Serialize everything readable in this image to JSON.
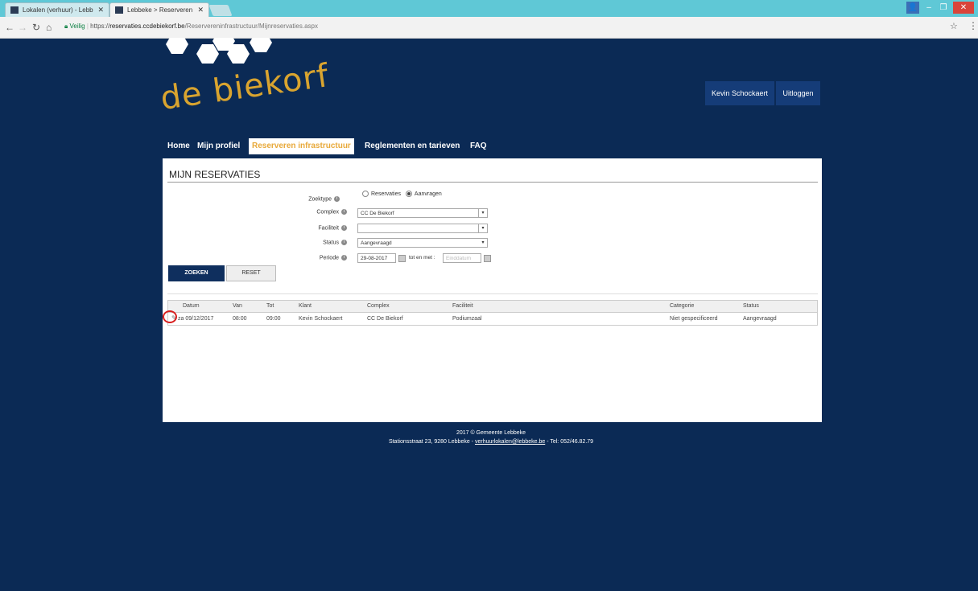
{
  "browser": {
    "tabs": [
      {
        "label": "Lokalen (verhuur) - Lebb"
      },
      {
        "label": "Lebbeke > Reserveren in"
      }
    ],
    "url": {
      "secure_label": "Veilig",
      "scheme": "https://",
      "host": "reservaties.ccdebiekorf.be",
      "path": "/Reservereninfrastructuur/Mijnreservaties.aspx"
    }
  },
  "header": {
    "logo_text": "de biekorf",
    "user_name": "Kevin Schockaert",
    "logout_label": "Uitloggen"
  },
  "nav": {
    "items": [
      {
        "label": "Home"
      },
      {
        "label": "Mijn profiel"
      },
      {
        "label": "Reserveren infrastructuur"
      },
      {
        "label": "Reglementen en tarieven"
      },
      {
        "label": "FAQ"
      }
    ],
    "active_index": 2
  },
  "page": {
    "title": "MIJN RESERVATIES",
    "form": {
      "zoektype_label": "Zoektype",
      "zoektype_options": [
        "Reservaties",
        "Aanvragen"
      ],
      "zoektype_selected": "Aanvragen",
      "complex_label": "Complex",
      "complex_value": "CC De Biekorf",
      "faciliteit_label": "Faciliteit",
      "faciliteit_value": "",
      "status_label": "Status",
      "status_value": "Aangevraagd",
      "periode_label": "Periode",
      "periode_start": "29-08-2017",
      "tot_en_met_label": "tot en met :",
      "periode_end_placeholder": "Einddatum"
    },
    "buttons": {
      "zoeken": "ZOEKEN",
      "reset": "RESET"
    },
    "table": {
      "columns": [
        "Datum",
        "Van",
        "Tot",
        "Klant",
        "Complex",
        "Faciliteit",
        "Categorie",
        "Status"
      ],
      "rows": [
        [
          "za 09/12/2017",
          "08:00",
          "09:00",
          "Kevin Schockaert",
          "CC De Biekorf",
          "Podiumzaal",
          "Niet gespecificeerd",
          "Aangevraagd"
        ]
      ]
    }
  },
  "footer": {
    "line1": "2017 © Gemeente Lebbeke",
    "address": "Stationsstraat 23, 9280 Lebbeke -",
    "email": "verhuurlokalen@lebbeke.be",
    "tel": "- Tel: 052/46.82.79"
  },
  "colors": {
    "background": "#0b2a55",
    "accent": "#e8a93a",
    "button_dark": "#0f2f5e",
    "header_button": "#153c78",
    "highlight_circle": "#d81e1e"
  }
}
